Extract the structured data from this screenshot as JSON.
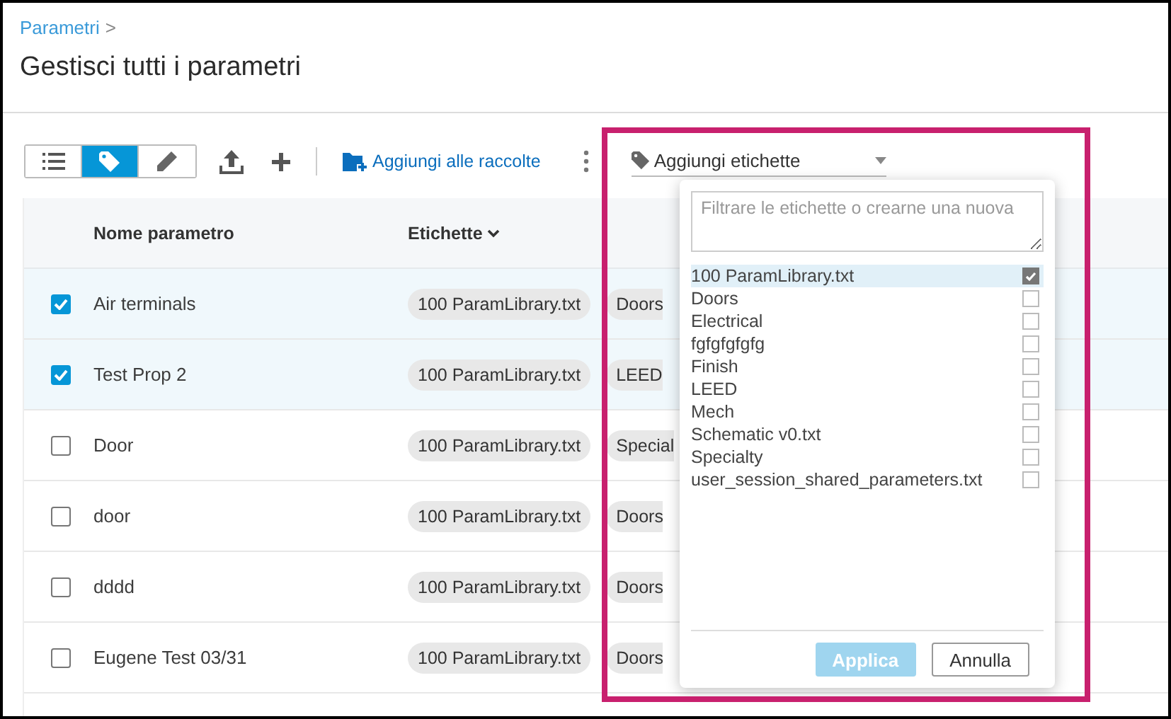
{
  "breadcrumb": {
    "label": "Parametri",
    "separator": ">"
  },
  "title": "Gestisci tutti i parametri",
  "toolbar": {
    "view_modes": [
      {
        "kind": "list",
        "selected": false
      },
      {
        "kind": "tag",
        "selected": true
      },
      {
        "kind": "edit",
        "selected": false
      }
    ],
    "add_to_collections": "Aggiungi alle raccolte",
    "tag_dropdown": "Aggiungi etichette"
  },
  "table": {
    "columns": [
      {
        "label": "Nome parametro",
        "sorted": false
      },
      {
        "label": "Etichette",
        "sorted": true
      }
    ],
    "rows": [
      {
        "name": "Air terminals",
        "checked": true,
        "tags": [
          "100 ParamLibrary.txt",
          "Doors"
        ]
      },
      {
        "name": "Test Prop 2",
        "checked": true,
        "tags": [
          "100 ParamLibrary.txt",
          "LEED"
        ]
      },
      {
        "name": "Door",
        "checked": false,
        "tags": [
          "100 ParamLibrary.txt",
          "Special"
        ]
      },
      {
        "name": "door",
        "checked": false,
        "tags": [
          "100 ParamLibrary.txt",
          "Doors"
        ]
      },
      {
        "name": "dddd",
        "checked": false,
        "tags": [
          "100 ParamLibrary.txt",
          "Doors"
        ]
      },
      {
        "name": "Eugene Test 03/31",
        "checked": false,
        "tags": [
          "100 ParamLibrary.txt",
          "Doors"
        ]
      }
    ]
  },
  "tag_menu": {
    "placeholder": "Filtrare le etichette o crearne una nuova",
    "options": [
      {
        "label": "100 ParamLibrary.txt",
        "checked": true,
        "selected": true
      },
      {
        "label": "Doors",
        "checked": false,
        "selected": false
      },
      {
        "label": "Electrical",
        "checked": false,
        "selected": false
      },
      {
        "label": "fgfgfgfgfg",
        "checked": false,
        "selected": false
      },
      {
        "label": "Finish",
        "checked": false,
        "selected": false
      },
      {
        "label": "LEED",
        "checked": false,
        "selected": false
      },
      {
        "label": "Mech",
        "checked": false,
        "selected": false
      },
      {
        "label": "Schematic v0.txt",
        "checked": false,
        "selected": false
      },
      {
        "label": "Specialty",
        "checked": false,
        "selected": false
      },
      {
        "label": "user_session_shared_parameters.txt",
        "checked": false,
        "selected": false
      }
    ],
    "buttons": [
      {
        "label": "Applica",
        "kind": "primary",
        "disabled": true
      },
      {
        "label": "Annulla",
        "kind": "secondary",
        "disabled": false
      }
    ]
  },
  "annotation_frame": true
}
